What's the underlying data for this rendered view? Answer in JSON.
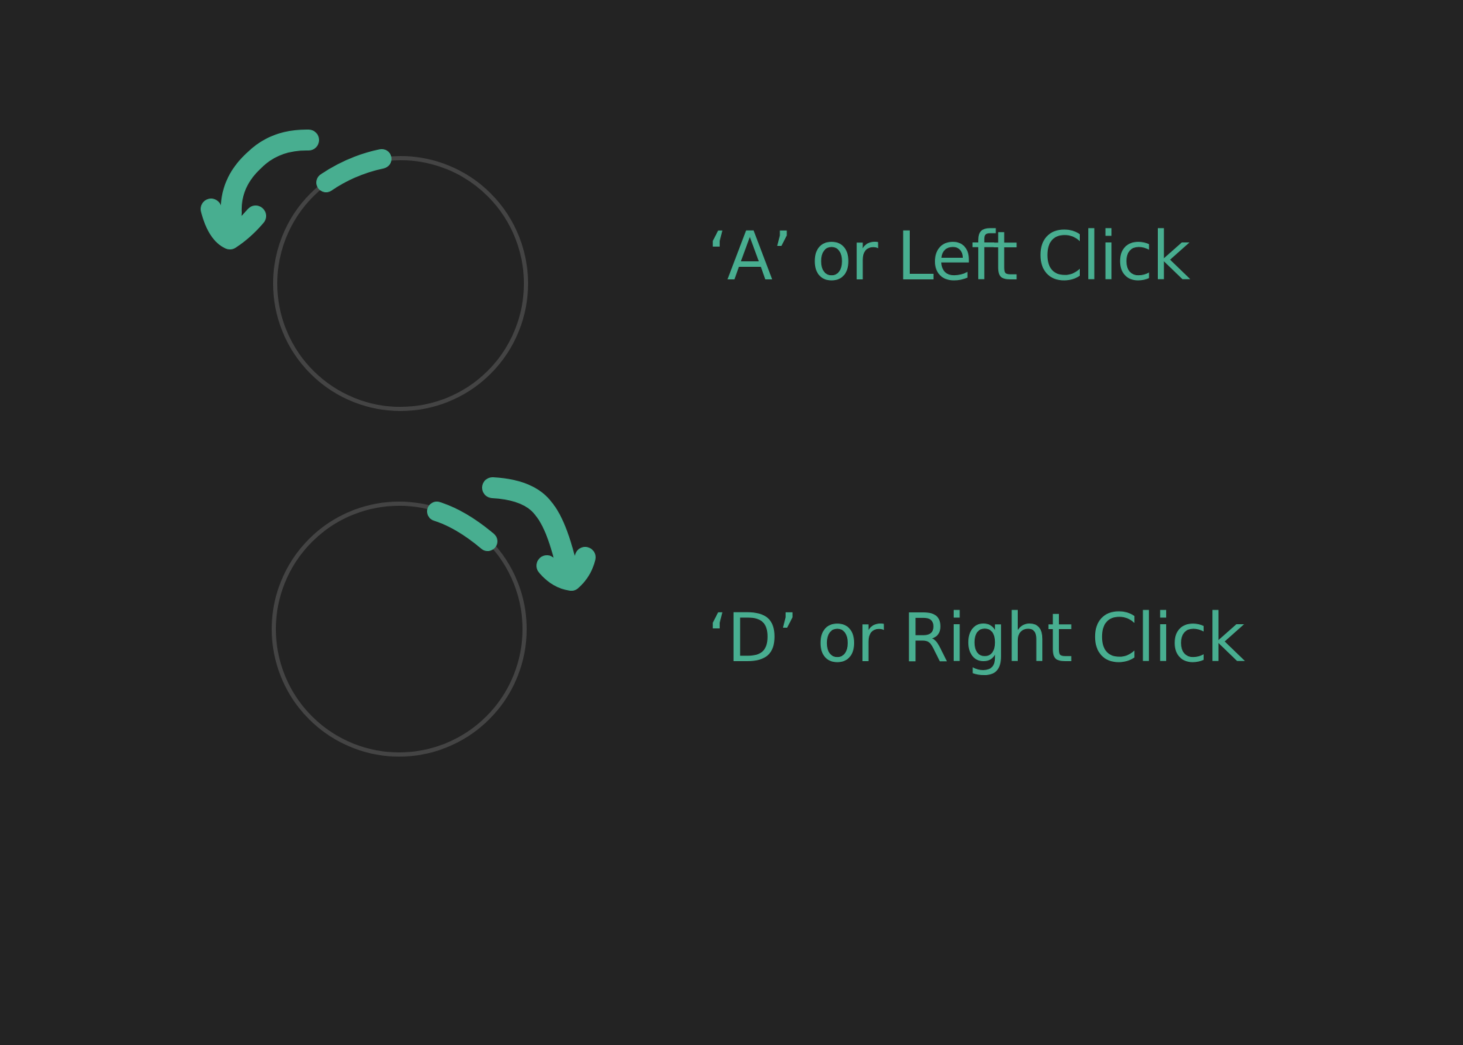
{
  "colors": {
    "background": "#232323",
    "circle_stroke": "#444444",
    "accent": "#48ae90"
  },
  "controls": [
    {
      "direction": "counter-clockwise",
      "icon": "rotate-counter-clockwise-icon",
      "label": "‘A’ or Left Click"
    },
    {
      "direction": "clockwise",
      "icon": "rotate-clockwise-icon",
      "label": "‘D’ or Right Click"
    }
  ]
}
